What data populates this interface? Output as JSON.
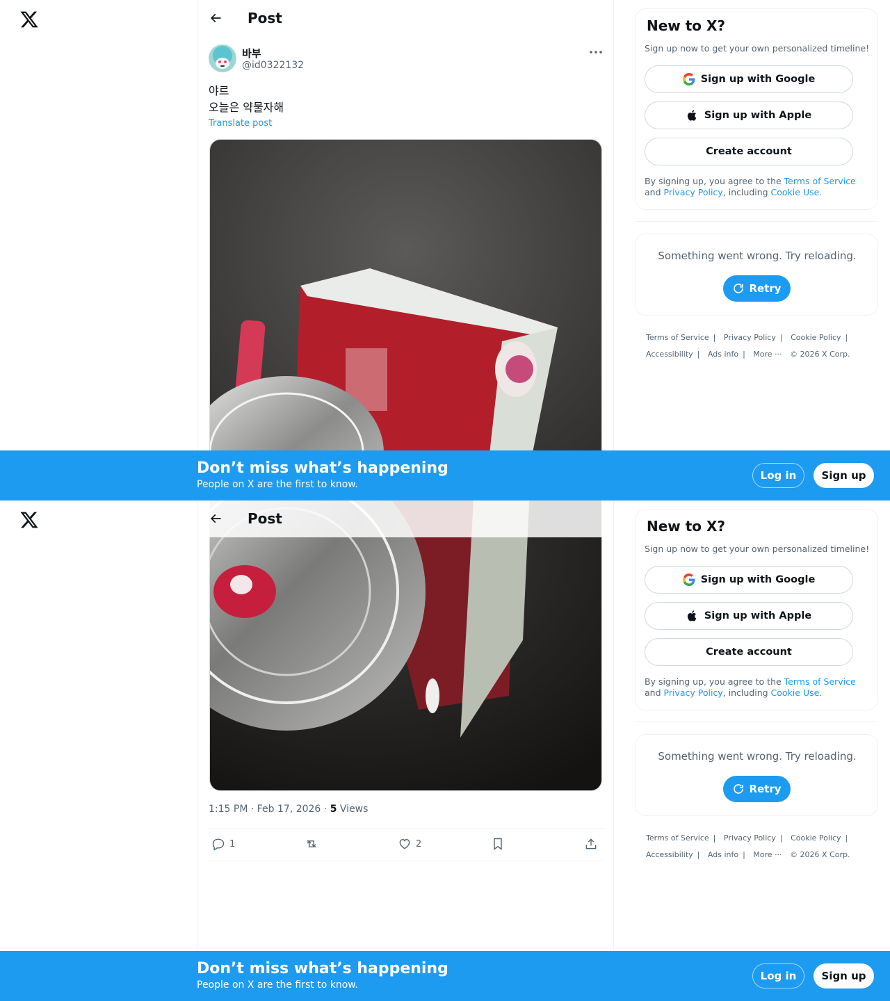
{
  "nav": {
    "logo_icon": "x-logo-icon"
  },
  "header": {
    "title": "Post",
    "back_icon": "arrow-left-icon"
  },
  "post": {
    "author_name": "바부",
    "author_handle": "@id0322132",
    "text_line1": "야르",
    "text_line2": "오늘은 약물자해",
    "translate_label": "Translate post",
    "time": "1:15 PM · Feb 17, 2026",
    "views_count": "5",
    "views_label": "Views",
    "replies": "1",
    "likes": "2"
  },
  "signup_card": {
    "title": "New to X?",
    "subtitle": "Sign up now to get your own personalized timeline!",
    "google_label": "Sign up with Google",
    "apple_label": "Sign up with Apple",
    "create_label": "Create account",
    "legal_prefix": "By signing up, you agree to the ",
    "terms_link": "Terms of Service",
    "legal_and": " and ",
    "privacy_link": "Privacy Policy",
    "legal_including": ", including ",
    "cookie_link": "Cookie Use."
  },
  "error_card": {
    "message": "Something went wrong. Try reloading.",
    "retry_label": "Retry"
  },
  "footer": {
    "terms": "Terms of Service",
    "privacy": "Privacy Policy",
    "cookie": "Cookie Policy",
    "accessibility": "Accessibility",
    "ads": "Ads info",
    "more": "More ···",
    "copyright": "© 2026 X Corp."
  },
  "banner": {
    "headline": "Don’t miss what’s happening",
    "subline": "People on X are the first to know.",
    "login_label": "Log in",
    "signup_label": "Sign up"
  },
  "colors": {
    "accent": "#1d9bf0",
    "text": "#0f1419",
    "muted": "#536471",
    "border": "#eff3f4"
  }
}
